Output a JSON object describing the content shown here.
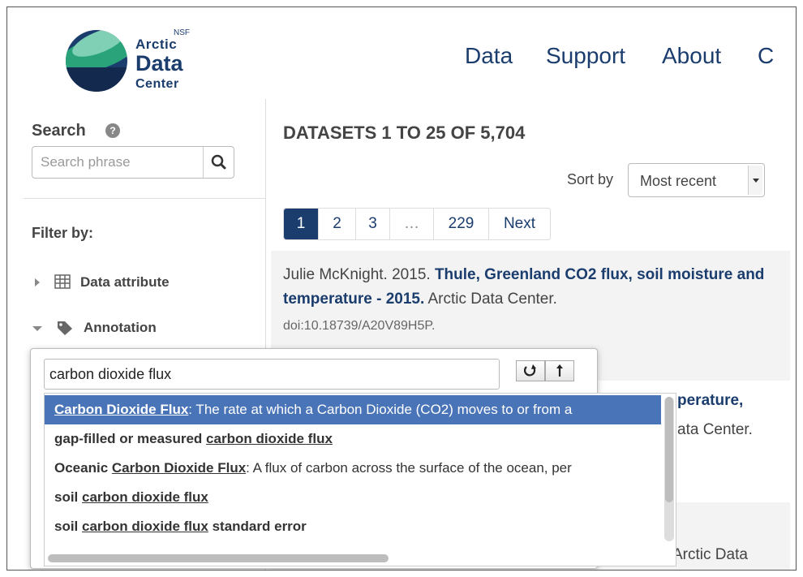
{
  "header": {
    "logo": {
      "nsf": "NSF",
      "line1": "Arctic",
      "line2": "Data",
      "line3": "Center"
    },
    "nav": [
      "Data",
      "Support",
      "About",
      "C"
    ]
  },
  "sidebar": {
    "search_label": "Search",
    "search_placeholder": "Search phrase",
    "filter_by": "Filter by:",
    "filters": [
      {
        "label": "Data attribute",
        "icon": "table-icon"
      },
      {
        "label": "Annotation",
        "icon": "tag-icon"
      }
    ]
  },
  "results": {
    "title": "DATASETS 1 TO 25 OF 5,704",
    "sort_label": "Sort by",
    "sort_value": "Most recent",
    "pages": [
      "1",
      "2",
      "3",
      "…",
      "229",
      "Next"
    ],
    "first": {
      "author": "Julie McKnight. 2015. ",
      "title": "Thule, Greenland CO2 flux, soil moisture and temperature - 2015.",
      "publisher": " Arctic Data Center.",
      "doi": "doi:10.18739/A20V89H5P."
    },
    "second_fragments": {
      "title_tail": "perature,",
      "publisher_tail": "ata Center."
    },
    "third_fragment": "Arctic Data"
  },
  "annotation_popup": {
    "input_value": "carbon dioxide flux",
    "undo_icon": "undo-icon",
    "upload_icon": "up-arrow-icon",
    "suggestions": [
      {
        "bold": "Carbon Dioxide Flux",
        "rest": ": The rate at which a Carbon Dioxide (CO2) moves to or from a"
      },
      {
        "pre": "gap-filled or measured ",
        "match": "carbon dioxide flux",
        "rest": ""
      },
      {
        "pre": "Oceanic ",
        "match": "Carbon Dioxide Flux",
        "rest": ": A flux of carbon across the surface of the ocean, per"
      },
      {
        "pre": "soil ",
        "match": "carbon dioxide flux",
        "rest": ""
      },
      {
        "pre": "soil ",
        "match": "carbon dioxide flux",
        "rest": " standard error"
      }
    ]
  },
  "colors": {
    "brand": "#1b3d6e",
    "highlight": "#4a74b8",
    "row_bg": "#f3f3f3"
  }
}
